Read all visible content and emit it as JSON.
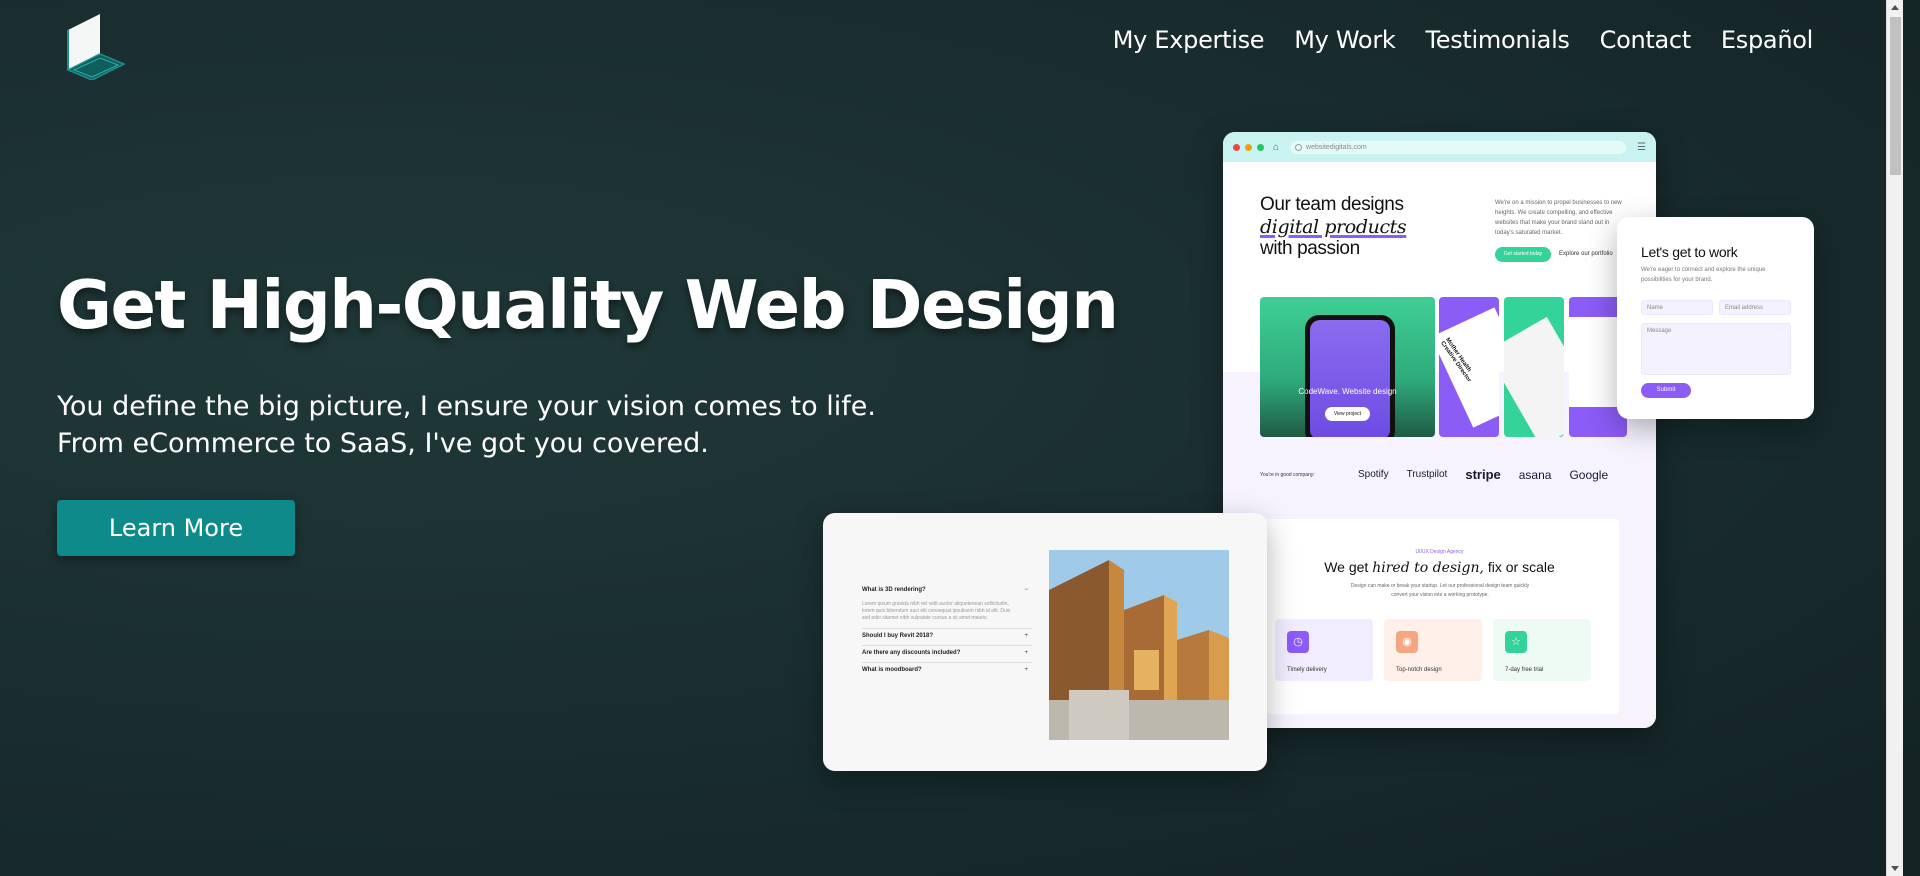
{
  "nav": {
    "items": [
      "My Expertise",
      "My Work",
      "Testimonials",
      "Contact",
      "Español"
    ]
  },
  "hero": {
    "title": "Get High-Quality Web Design",
    "subtitle_line1": "You define the big picture, I ensure your vision comes to life.",
    "subtitle_line2": "From eCommerce to SaaS, I've got you covered.",
    "cta": "Learn More"
  },
  "mockup": {
    "url": "websitedigitals.com",
    "title_line1": "Our team designs",
    "title_em": "digital products",
    "title_line3": "with passion",
    "intro": "We're on a mission to propel businesses to new heights. We create compelling, and effective websites that make your brand stand out in today's saturated market.",
    "primary_pill": "Get started today",
    "secondary_link": "Explore our portfolio",
    "card_caption": "CodeWave. Website design",
    "card_button": "View project",
    "card2_title": "Mother Health Creative Director",
    "good_company": "You're in good company:",
    "brands": [
      "Spotify",
      "Trustpilot",
      "stripe",
      "asana",
      "Google"
    ],
    "agency_tag": "UI/UX Design Agency",
    "agency_title_a": "We get ",
    "agency_title_em": "hired to design,",
    "agency_title_b": " fix or scale",
    "agency_sub": "Design can make or break your startup. Let our professional design team quickly convert your vision into a working prototype.",
    "features": [
      "Timely delivery",
      "Top-notch design",
      "7-day free trial"
    ]
  },
  "contact": {
    "title": "Let's get to work",
    "subtitle": "We're eager to connect and explore the unique possibilities for your brand.",
    "name_placeholder": "Name",
    "email_placeholder": "Email address",
    "message_placeholder": "Message",
    "submit": "Submit"
  },
  "faq": {
    "items": [
      {
        "q": "What is 3D rendering?",
        "sign": "−",
        "a": "Lorem ipsum gravida nibh vel velit auctor aliquetenean sollicitudin, lorem quis bibendum auci elit consequat ipsutisem nibh id elit. Duis sed odio sitamet nibh vulputate cursus a sit amet mauris."
      },
      {
        "q": "Should I buy Revit 2018?",
        "sign": "+",
        "a": ""
      },
      {
        "q": "Are there any discounts included?",
        "sign": "+",
        "a": ""
      },
      {
        "q": "What is moodboard?",
        "sign": "+",
        "a": ""
      }
    ]
  },
  "colors": {
    "accent": "#0e8a8a",
    "purple": "#8b5cf6",
    "green": "#34d399",
    "background": "#1a2e30"
  }
}
